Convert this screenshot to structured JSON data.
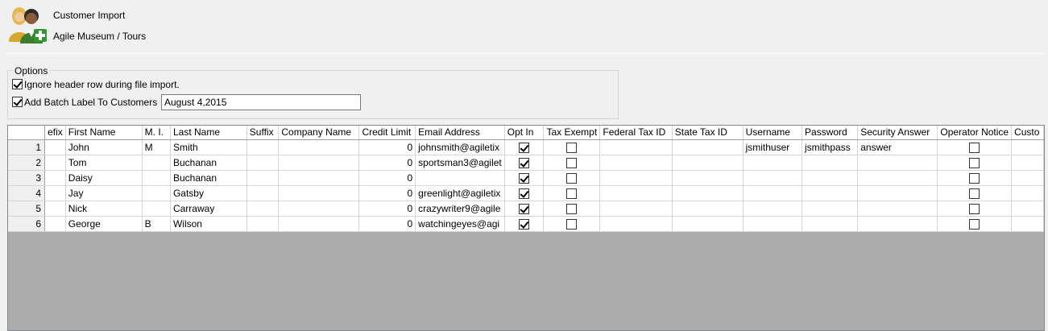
{
  "header": {
    "title": "Customer Import",
    "subtitle": "Agile Museum / Tours",
    "icon": "customers-add-icon"
  },
  "options": {
    "legend": "Options",
    "ignore_header": {
      "label": "Ignore header row during file import.",
      "checked": true
    },
    "batch_label": {
      "label": "Add Batch Label To Customers",
      "checked": true,
      "value": "August 4,2015"
    }
  },
  "grid": {
    "columns": [
      "efix",
      "First Name",
      "M. I.",
      "Last Name",
      "Suffix",
      "Company Name",
      "Credit Limit",
      "Email Address",
      "Opt In",
      "Tax Exempt",
      "Federal Tax ID",
      "State Tax ID",
      "Username",
      "Password",
      "Security Answer",
      "Operator Notice",
      "Custo"
    ],
    "rows": [
      {
        "n": "1",
        "prefix": "",
        "first": "John",
        "mi": "M",
        "last": "Smith",
        "suffix": "",
        "company": "",
        "credit": "0",
        "email": "johnsmith@agiletix",
        "optin": true,
        "taxexempt": false,
        "fed": "",
        "state": "",
        "username": "jsmithuser",
        "password": "jsmithpass",
        "answer": "answer",
        "notice": false,
        "custo": ""
      },
      {
        "n": "2",
        "prefix": "",
        "first": "Tom",
        "mi": "",
        "last": "Buchanan",
        "suffix": "",
        "company": "",
        "credit": "0",
        "email": "sportsman3@agilet",
        "optin": true,
        "taxexempt": false,
        "fed": "",
        "state": "",
        "username": "",
        "password": "",
        "answer": "",
        "notice": false,
        "custo": ""
      },
      {
        "n": "3",
        "prefix": "",
        "first": "Daisy",
        "mi": "",
        "last": "Buchanan",
        "suffix": "",
        "company": "",
        "credit": "0",
        "email": "",
        "optin": true,
        "taxexempt": false,
        "fed": "",
        "state": "",
        "username": "",
        "password": "",
        "answer": "",
        "notice": false,
        "custo": ""
      },
      {
        "n": "4",
        "prefix": "",
        "first": "Jay",
        "mi": "",
        "last": "Gatsby",
        "suffix": "",
        "company": "",
        "credit": "0",
        "email": "greenlight@agiletix",
        "optin": true,
        "taxexempt": false,
        "fed": "",
        "state": "",
        "username": "",
        "password": "",
        "answer": "",
        "notice": false,
        "custo": ""
      },
      {
        "n": "5",
        "prefix": "",
        "first": "Nick",
        "mi": "",
        "last": "Carraway",
        "suffix": "",
        "company": "",
        "credit": "0",
        "email": "crazywriter9@agile",
        "optin": true,
        "taxexempt": false,
        "fed": "",
        "state": "",
        "username": "",
        "password": "",
        "answer": "",
        "notice": false,
        "custo": ""
      },
      {
        "n": "6",
        "prefix": "",
        "first": "George",
        "mi": "B",
        "last": "Wilson",
        "suffix": "",
        "company": "",
        "credit": "0",
        "email": "watchingeyes@agi",
        "optin": true,
        "taxexempt": false,
        "fed": "",
        "state": "",
        "username": "",
        "password": "",
        "answer": "",
        "notice": false,
        "custo": ""
      }
    ]
  }
}
